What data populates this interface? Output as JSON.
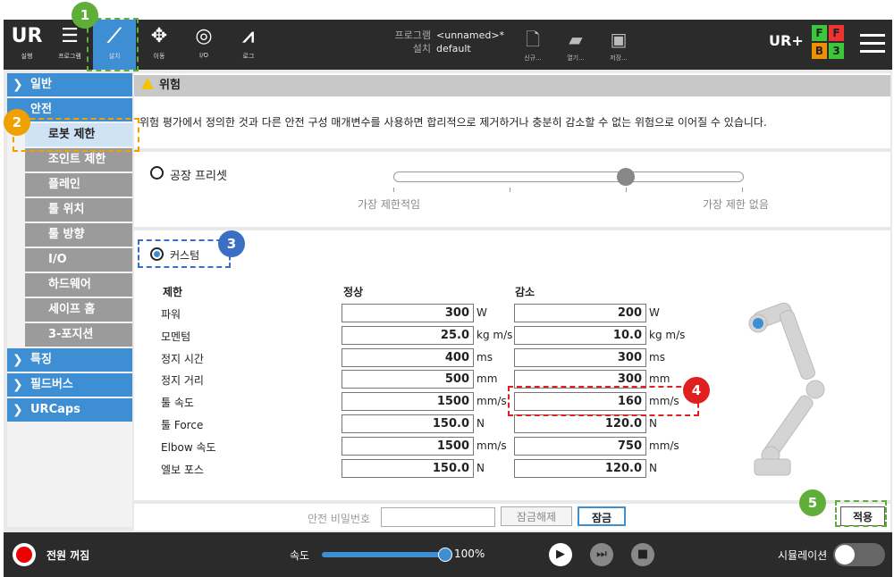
{
  "topbar": {
    "nav": [
      {
        "label": "실행",
        "icon": "ur-logo-icon"
      },
      {
        "label": "프로그램",
        "icon": "program-icon"
      },
      {
        "label": "설치",
        "icon": "installation-icon"
      },
      {
        "label": "이동",
        "icon": "move-icon"
      },
      {
        "label": "I/O",
        "icon": "io-icon"
      },
      {
        "label": "로그",
        "icon": "log-icon"
      }
    ],
    "program_key": "프로그램",
    "program_val": "<unnamed>*",
    "install_key": "설치",
    "install_val": "default",
    "file_new": "신규...",
    "file_open": "열기...",
    "file_save": "저장...",
    "urplus": "UR+",
    "status": {
      "f1": "F",
      "f2": "F",
      "b": "B",
      "three": "3"
    }
  },
  "sidebar": {
    "general": "일반",
    "safety": "안전",
    "subitems": [
      "로봇 제한",
      "조인트 제한",
      "플레인",
      "툴 위치",
      "툴 방향",
      "I/O",
      "하드웨어",
      "세이프 홈",
      "3-포지션"
    ],
    "features": "특징",
    "fieldbus": "필드버스",
    "urcaps": "URCaps"
  },
  "content": {
    "warning_title": "위험",
    "warning_text": "위험 평가에서 정의한 것과 다른 안전 구성 매개변수를 사용하면 합리적으로 제거하거나 충분히 감소할 수 없는 위험으로 이어질 수 있습니다.",
    "factory_preset": "공장 프리셋",
    "most_restrictive": "가장 제한적임",
    "least_restrictive": "가장 제한 없음",
    "custom": "커스텀",
    "col_limit": "제한",
    "col_normal": "정상",
    "col_reduced": "감소",
    "rows": [
      {
        "label": "파워",
        "normal": "300",
        "nu": "W",
        "reduced": "200",
        "ru": "W"
      },
      {
        "label": "모멘텀",
        "normal": "25.0",
        "nu": "kg m/s",
        "reduced": "10.0",
        "ru": "kg m/s"
      },
      {
        "label": "정지 시간",
        "normal": "400",
        "nu": "ms",
        "reduced": "300",
        "ru": "ms"
      },
      {
        "label": "정지 거리",
        "normal": "500",
        "nu": "mm",
        "reduced": "300",
        "ru": "mm"
      },
      {
        "label": "툴 속도",
        "normal": "1500",
        "nu": "mm/s",
        "reduced": "160",
        "ru": "mm/s"
      },
      {
        "label": "툴 Force",
        "normal": "150.0",
        "nu": "N",
        "reduced": "120.0",
        "ru": "N"
      },
      {
        "label": "Elbow 속도",
        "normal": "1500",
        "nu": "mm/s",
        "reduced": "750",
        "ru": "mm/s"
      },
      {
        "label": "엘보 포스",
        "normal": "150.0",
        "nu": "N",
        "reduced": "120.0",
        "ru": "N"
      }
    ],
    "password_label": "안전 비밀번호",
    "password_value": "",
    "unlock": "잠금해제",
    "lock": "잠금",
    "apply": "적용"
  },
  "footer": {
    "power": "전원 꺼짐",
    "speed_label": "속도",
    "speed_value": "100%",
    "speed_fraction": 1.0,
    "simulation": "시뮬레이션"
  },
  "annotations": [
    "1",
    "2",
    "3",
    "4",
    "5"
  ],
  "colors": {
    "accent": "#3d8ed2",
    "topbar": "#2b2b2b",
    "green_ann": "#5fae3a",
    "orange_ann": "#f0a000",
    "blue_ann": "#3a6fc4",
    "red_ann": "#e02020"
  }
}
